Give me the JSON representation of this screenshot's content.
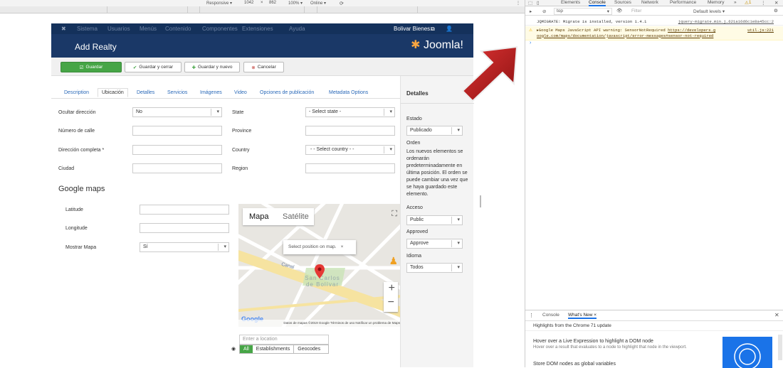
{
  "devbar": {
    "responsive": "Responsive ▾",
    "width": "1042",
    "times": "×",
    "height": "862",
    "zoom": "100% ▾",
    "online": "Online ▾"
  },
  "joomla": {
    "nav": [
      "Sistema",
      "Usuarios",
      "Menús",
      "Contenido",
      "Componentes",
      "Extensiones",
      "Ayuda"
    ],
    "user": "Bolivar Bienes...",
    "title": "Add Realty",
    "logo": "Joomla!"
  },
  "toolbar": {
    "save": "Guardar",
    "save_close": "Guardar y cerrar",
    "save_new": "Guardar y nuevo",
    "cancel": "Cancelar"
  },
  "tabs": [
    "Description",
    "Ubicación",
    "Detalles",
    "Servicios",
    "Imágenes",
    "Video",
    "Opciones de publicación",
    "Metadata Options"
  ],
  "form": {
    "ocultar_label": "Ocultar dirección",
    "ocultar_value": "No",
    "numero_label": "Número de calle",
    "direccion_label": "Dirección completa *",
    "ciudad_label": "Ciudad",
    "state_label": "State",
    "state_value": "- Select state -",
    "province_label": "Province",
    "country_label": "Country",
    "country_value": "- - Select country - -",
    "region_label": "Region"
  },
  "maps": {
    "heading": "Google maps",
    "latitude": "Latitude",
    "longitude": "Longitude",
    "mostrar": "Mostrar Mapa",
    "mostrar_value": "Sí",
    "map_tab": "Mapa",
    "sat_tab": "Satélite",
    "tooltip": "Select position on map.",
    "city": "San Carlos de Bolívar",
    "canal": "Canal",
    "footer": "Datos de mapas ©2019 Google   Términos de uso   Notificar un problema de Maps",
    "location_placeholder": "Enter a location",
    "opt_all": "All",
    "opt_est": "Establishments",
    "opt_geo": "Geocodes"
  },
  "sidebar": {
    "title": "Detalles",
    "estado_label": "Estado",
    "estado_value": "Publicado",
    "orden_label": "Orden",
    "orden_text": "Los nuevos elementos se ordenarán predeterminadamente en última posición. El orden se puede cambiar una vez que se haya guardado este elemento.",
    "acceso_label": "Acceso",
    "acceso_value": "Public",
    "approved_label": "Approved",
    "approved_value": "Approve",
    "idioma_label": "Idioma",
    "idioma_value": "Todos"
  },
  "devtools": {
    "tabs": [
      "Elements",
      "Console",
      "Sources",
      "Network",
      "Performance",
      "Memory",
      "»"
    ],
    "warn_count": "1",
    "context": "top",
    "filter_placeholder": "Filter",
    "levels": "Default levels ▾",
    "log1": "JQMIGRATE: Migrate is installed, version 1.4.1",
    "log1_src": "jquery-migrate.min.j…621a16d6c1e8a45cc:2",
    "warn_text": "▸Google Maps JavaScript API warning: SensorNotRequired",
    "warn_link": "https://developers.g oogle.com/maps/documentation/javascript/error-messages#sensor-not-required",
    "warn_src": "util.js:221",
    "drawer_tabs": [
      "Console",
      "What's New ×"
    ],
    "highlights": "Highlights from the Chrome 71 update",
    "item1_title": "Hover over a Live Expression to highlight a DOM node",
    "item1_desc": "Hover over a result that evaluates to a node to highlight that node in the viewport.",
    "item2_title": "Store DOM nodes as global variables"
  },
  "colors": {
    "header": "#1a3867",
    "save": "#46a546",
    "link": "#2a69b8",
    "arrow": "#b01c1c"
  }
}
